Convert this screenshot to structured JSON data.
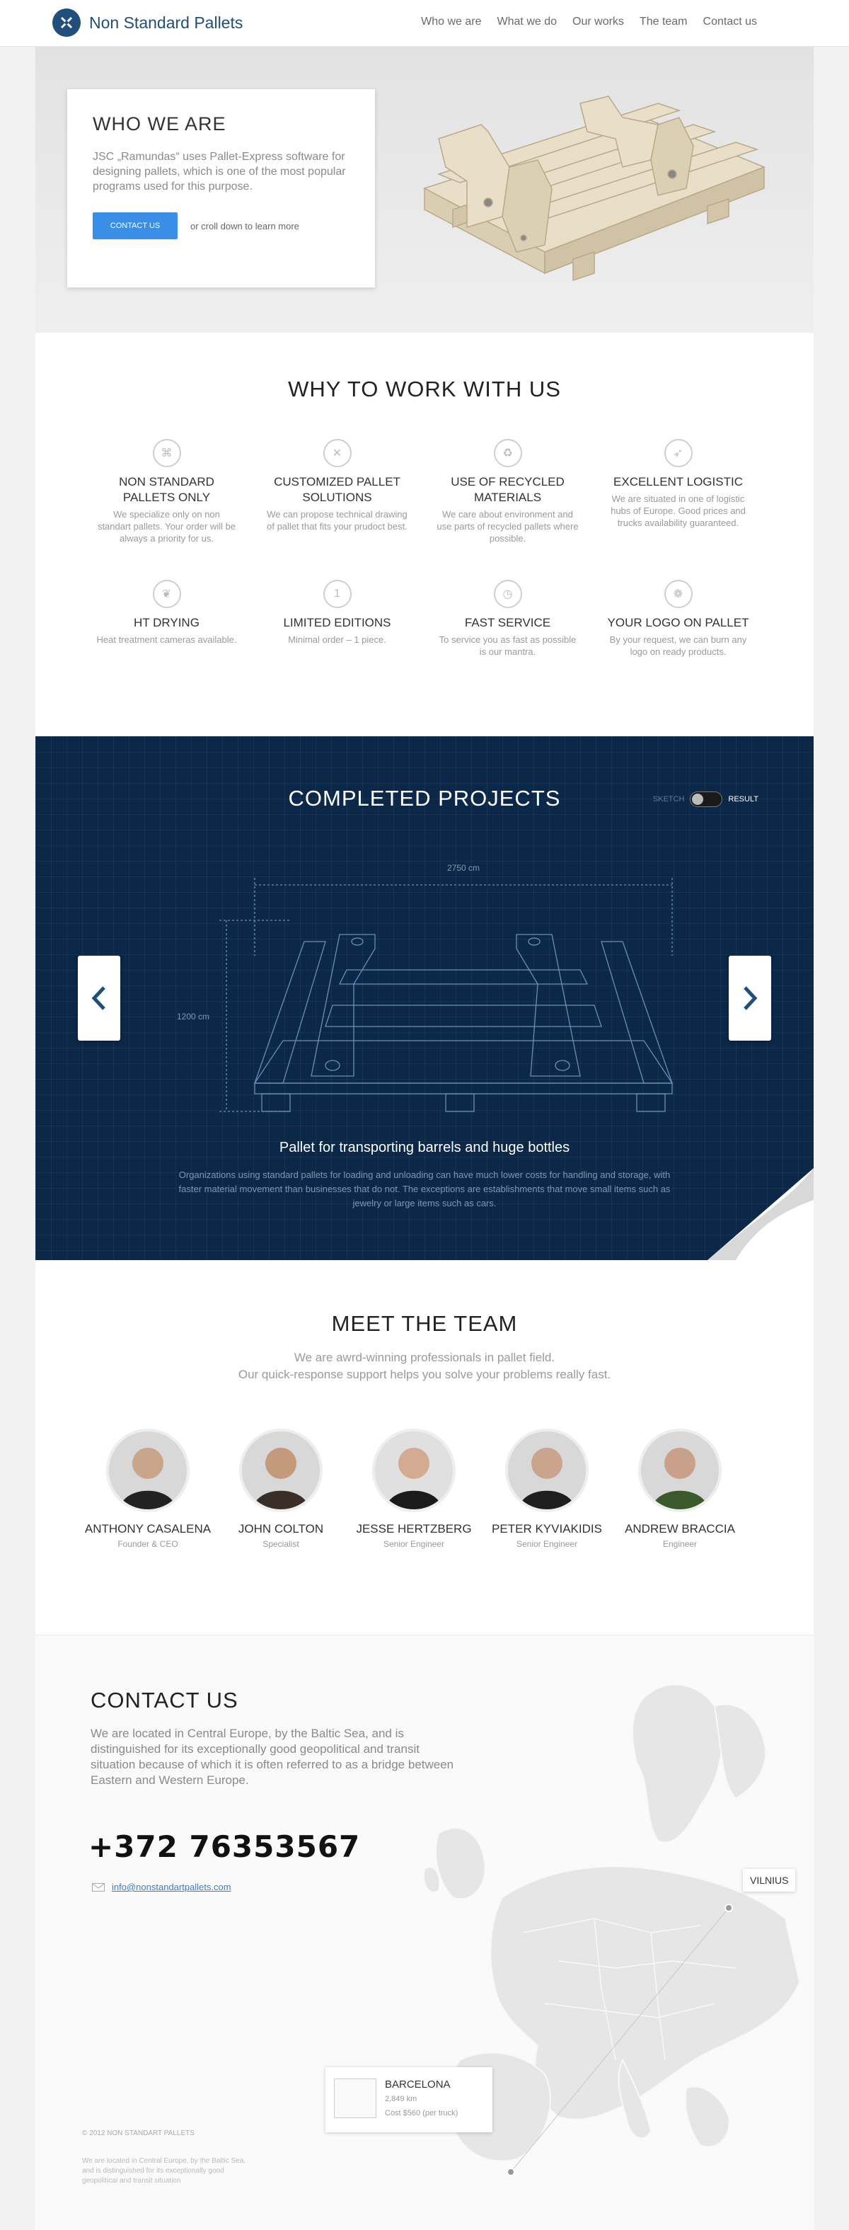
{
  "brand": {
    "name": "Non Standard Pallets",
    "accent": "#1f4f7a"
  },
  "nav": [
    "Who we are",
    "What we do",
    "Our works",
    "The team",
    "Contact us"
  ],
  "hero": {
    "title": "WHO WE ARE",
    "text": "JSC „Ramundas“ uses Pallet-Express software for designing pallets, which is one of the most popular programs used for this purpose.",
    "button": "CONTACT US",
    "scroll_hint": "or croll down to learn more"
  },
  "why": {
    "title": "WHY TO WORK WITH US",
    "features": [
      {
        "icon": "pallet-icon",
        "title": "NON STANDARD PALLETS ONLY",
        "text": "We specialize only on non standart pallets. Your order will be always a priority for us."
      },
      {
        "icon": "tools-icon",
        "title": "CUSTOMIZED PALLET SOLUTIONS",
        "text": "We can propose technical drawing of pallet that fits your prudoct best."
      },
      {
        "icon": "recycle-icon",
        "title": "USE OF RECYCLED MATERIALS",
        "text": "We care about environment and use parts of recycled pallets where possible."
      },
      {
        "icon": "logistic-icon",
        "title": "EXCELLENT LOGISTIC",
        "text": "We are situated in one of logistic hubs of Europe. Good prices and trucks availability guaranteed."
      },
      {
        "icon": "leaf-icon",
        "title": "HT DRYING",
        "text": "Heat treatment cameras available."
      },
      {
        "icon": "limited-icon",
        "title": "LIMITED EDITIONS",
        "text": "Minimal order – 1 piece."
      },
      {
        "icon": "clock-icon",
        "title": "FAST SERVICE",
        "text": "To service you as fast as possible is our mantra."
      },
      {
        "icon": "logo-icon",
        "title": "YOUR LOGO ON PALLET",
        "text": "By your request, we can burn any logo on ready products."
      }
    ]
  },
  "projects": {
    "title": "COMPLETED PROJECTS",
    "toggle_off": "SKETCH",
    "toggle_on": "RESULT",
    "width_label": "2750 cm",
    "height_label": "1200 cm",
    "project_title": "Pallet for transporting barrels and huge bottles",
    "project_text": "Organizations using standard pallets for loading and unloading can have much lower costs for handling and storage, with faster material movement than businesses that do not. The exceptions are establishments that move small items such as jewelry or large items such as cars."
  },
  "team": {
    "title": "MEET THE TEAM",
    "subtitle_1": "We are awrd-winning professionals in pallet field.",
    "subtitle_2": "Our quick-response support helps you solve your problems really fast.",
    "members": [
      {
        "name": "ANTHONY CASALENA",
        "role": "Founder & CEO"
      },
      {
        "name": "JOHN COLTON",
        "role": "Specialist"
      },
      {
        "name": "JESSE HERTZBERG",
        "role": "Senior Engineer"
      },
      {
        "name": "PETER KYVIAKIDIS",
        "role": "Senior Engineer"
      },
      {
        "name": "ANDREW BRACCIA",
        "role": "Engineer"
      }
    ]
  },
  "contact": {
    "title": "CONTACT US",
    "intro": "We are located in Central Europe, by the Baltic Sea, and is distinguished for its exceptionally good geopolitical and transit situation because of which it is often referred to as a bridge between Eastern and Western Europe.",
    "phone": "+372 76353567",
    "email": "info@nonstandartpallets.com",
    "map_labels": {
      "vilnius": "VILNIUS",
      "barcelona": "BARCELONA",
      "distance": "2,849 km",
      "cost": "Cost $560 (per truck)"
    }
  },
  "footer": {
    "copyright": "© 2012 NON STANDART PALLETS",
    "text": "We are located in Central Europe, by the Baltic Sea, and is distinguished for its exceptionally good geopolitical and transit situation"
  }
}
